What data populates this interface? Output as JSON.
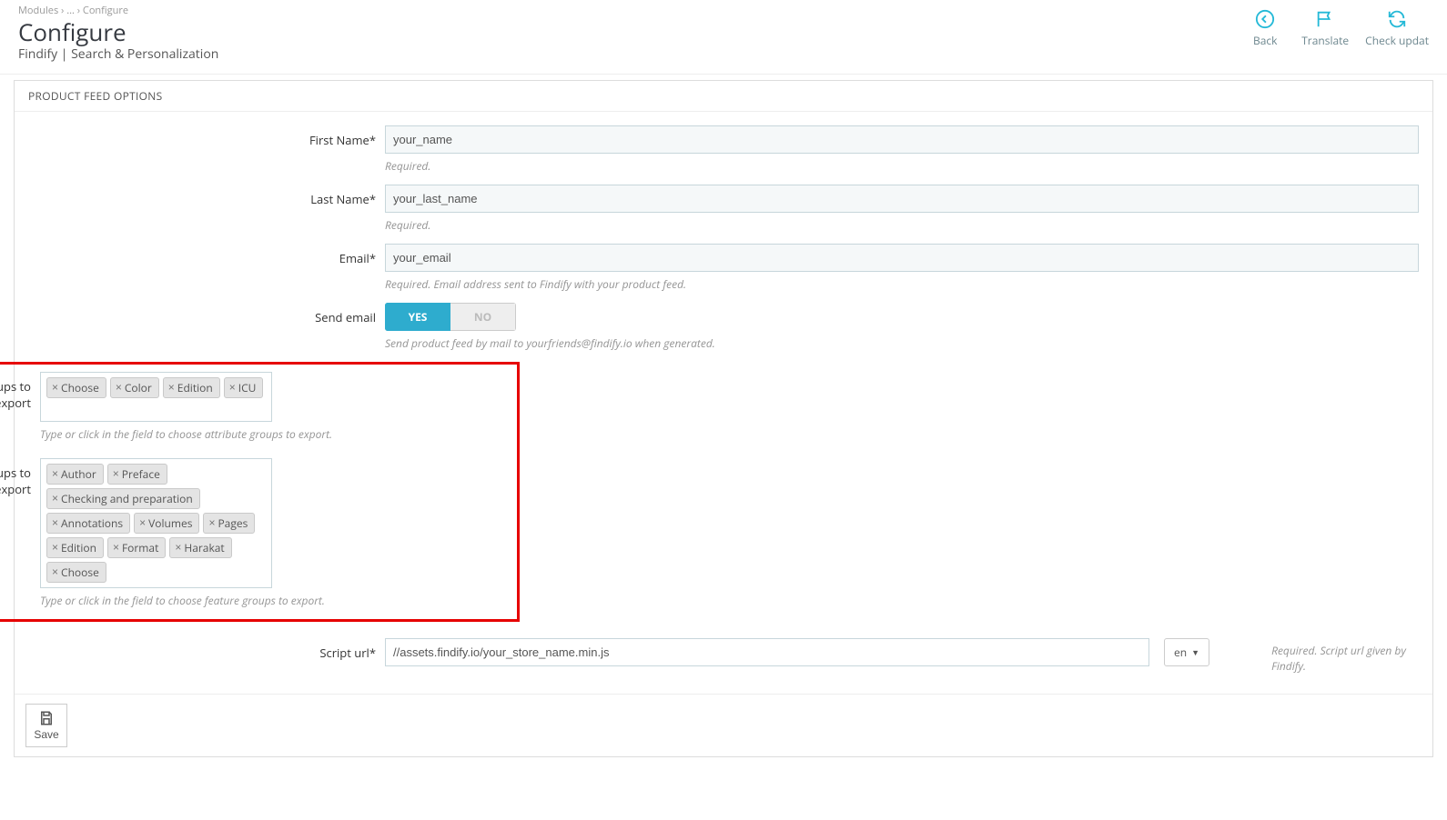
{
  "breadcrumb": "Modules  ›  ...  ›  Configure",
  "title": "Configure",
  "subtitle": "Findify | Search & Personalization",
  "header_actions": {
    "back": "Back",
    "translate": "Translate",
    "check_updates": "Check updat"
  },
  "panel": {
    "heading": "PRODUCT FEED OPTIONS"
  },
  "fields": {
    "first_name": {
      "label": "First Name*",
      "value": "your_name",
      "help": "Required."
    },
    "last_name": {
      "label": "Last Name*",
      "value": "your_last_name",
      "help": "Required."
    },
    "email": {
      "label": "Email*",
      "value": "your_email",
      "help": "Required. Email address sent to Findify with your product feed."
    },
    "send_email": {
      "label": "Send email",
      "yes": "YES",
      "no": "NO",
      "help": "Send product feed by mail to yourfriends@findify.io when generated."
    },
    "attribute_groups": {
      "label": "Attribute groups to export",
      "tags": [
        "Choose",
        "Color",
        "Edition",
        "ICU"
      ],
      "help": "Type or click in the field to choose attribute groups to export."
    },
    "feature_groups": {
      "label": "Feature groups to export",
      "tags": [
        "Author",
        "Preface",
        "Checking and preparation",
        "Annotations",
        "Volumes",
        "Pages",
        "Edition",
        "Format",
        "Harakat",
        "Choose"
      ],
      "help": "Type or click in the field to choose feature groups to export."
    },
    "script_url": {
      "label": "Script url*",
      "value": "//assets.findify.io/your_store_name.min.js",
      "lang": "en",
      "help": "Required. Script url given by Findify."
    }
  },
  "footer": {
    "save": "Save"
  }
}
